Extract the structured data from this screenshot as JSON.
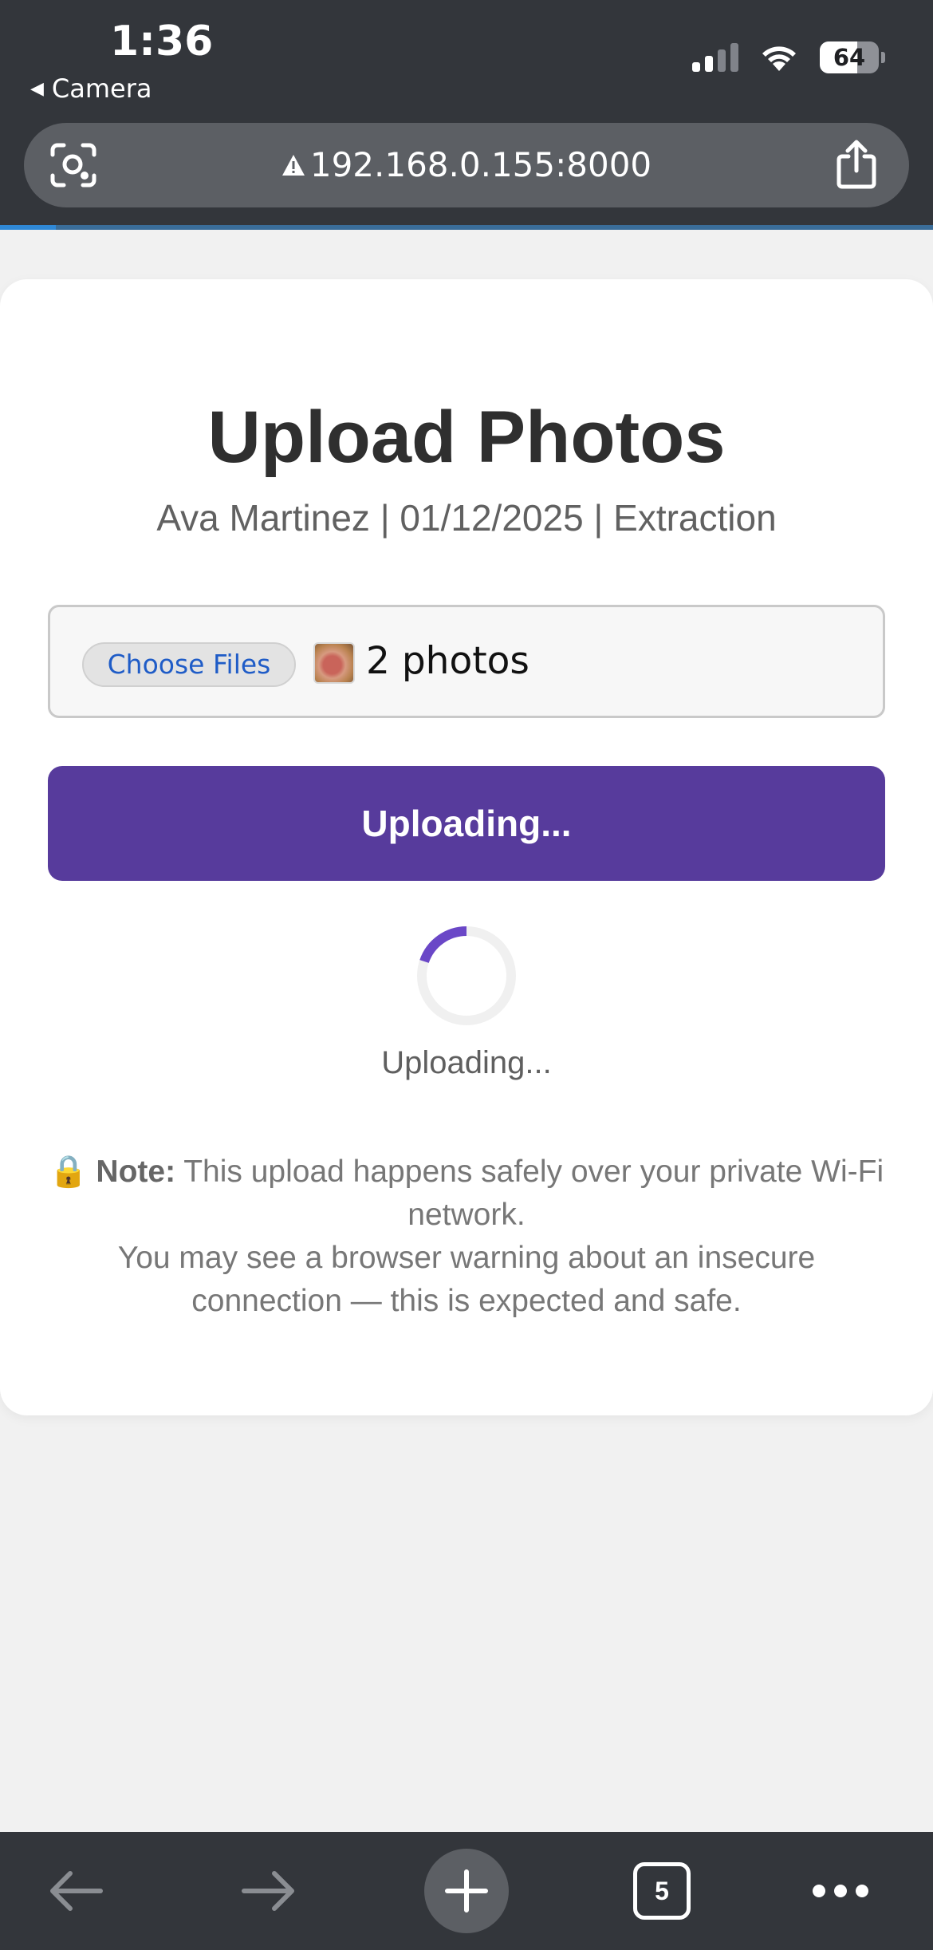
{
  "status_bar": {
    "time": "1:36",
    "back_app": "Camera",
    "battery_percent": "64",
    "battery_level": 0.64,
    "signal_bars_active": 2,
    "signal_bars_total": 4
  },
  "browser": {
    "url": "192.168.0.155:8000",
    "connection": "not-secure",
    "page_load_progress": 0.06,
    "open_tabs": "5"
  },
  "page": {
    "title": "Upload Photos",
    "subtitle": "Ava Martinez | 01/12/2025 | Extraction",
    "file_input": {
      "button_label": "Choose Files",
      "selection_text": "2 photos"
    },
    "upload_button_label": "Uploading...",
    "spinner_text": "Uploading...",
    "note": {
      "icon": "🔒",
      "label": "Note:",
      "line1": "This upload happens safely over your private Wi-Fi network.",
      "line2": "You may see a browser warning about an insecure connection — this is expected and safe."
    }
  },
  "colors": {
    "accent": "#573b9c",
    "spinner_arc": "#6a47c7",
    "chrome_bg": "#33363b",
    "link_blue": "#1f5cc7"
  },
  "icons": [
    "warning-icon",
    "visual-lookup-icon",
    "share-icon",
    "back-arrow-icon",
    "forward-arrow-icon",
    "plus-icon",
    "tabs-icon",
    "more-icon",
    "lock-icon"
  ]
}
